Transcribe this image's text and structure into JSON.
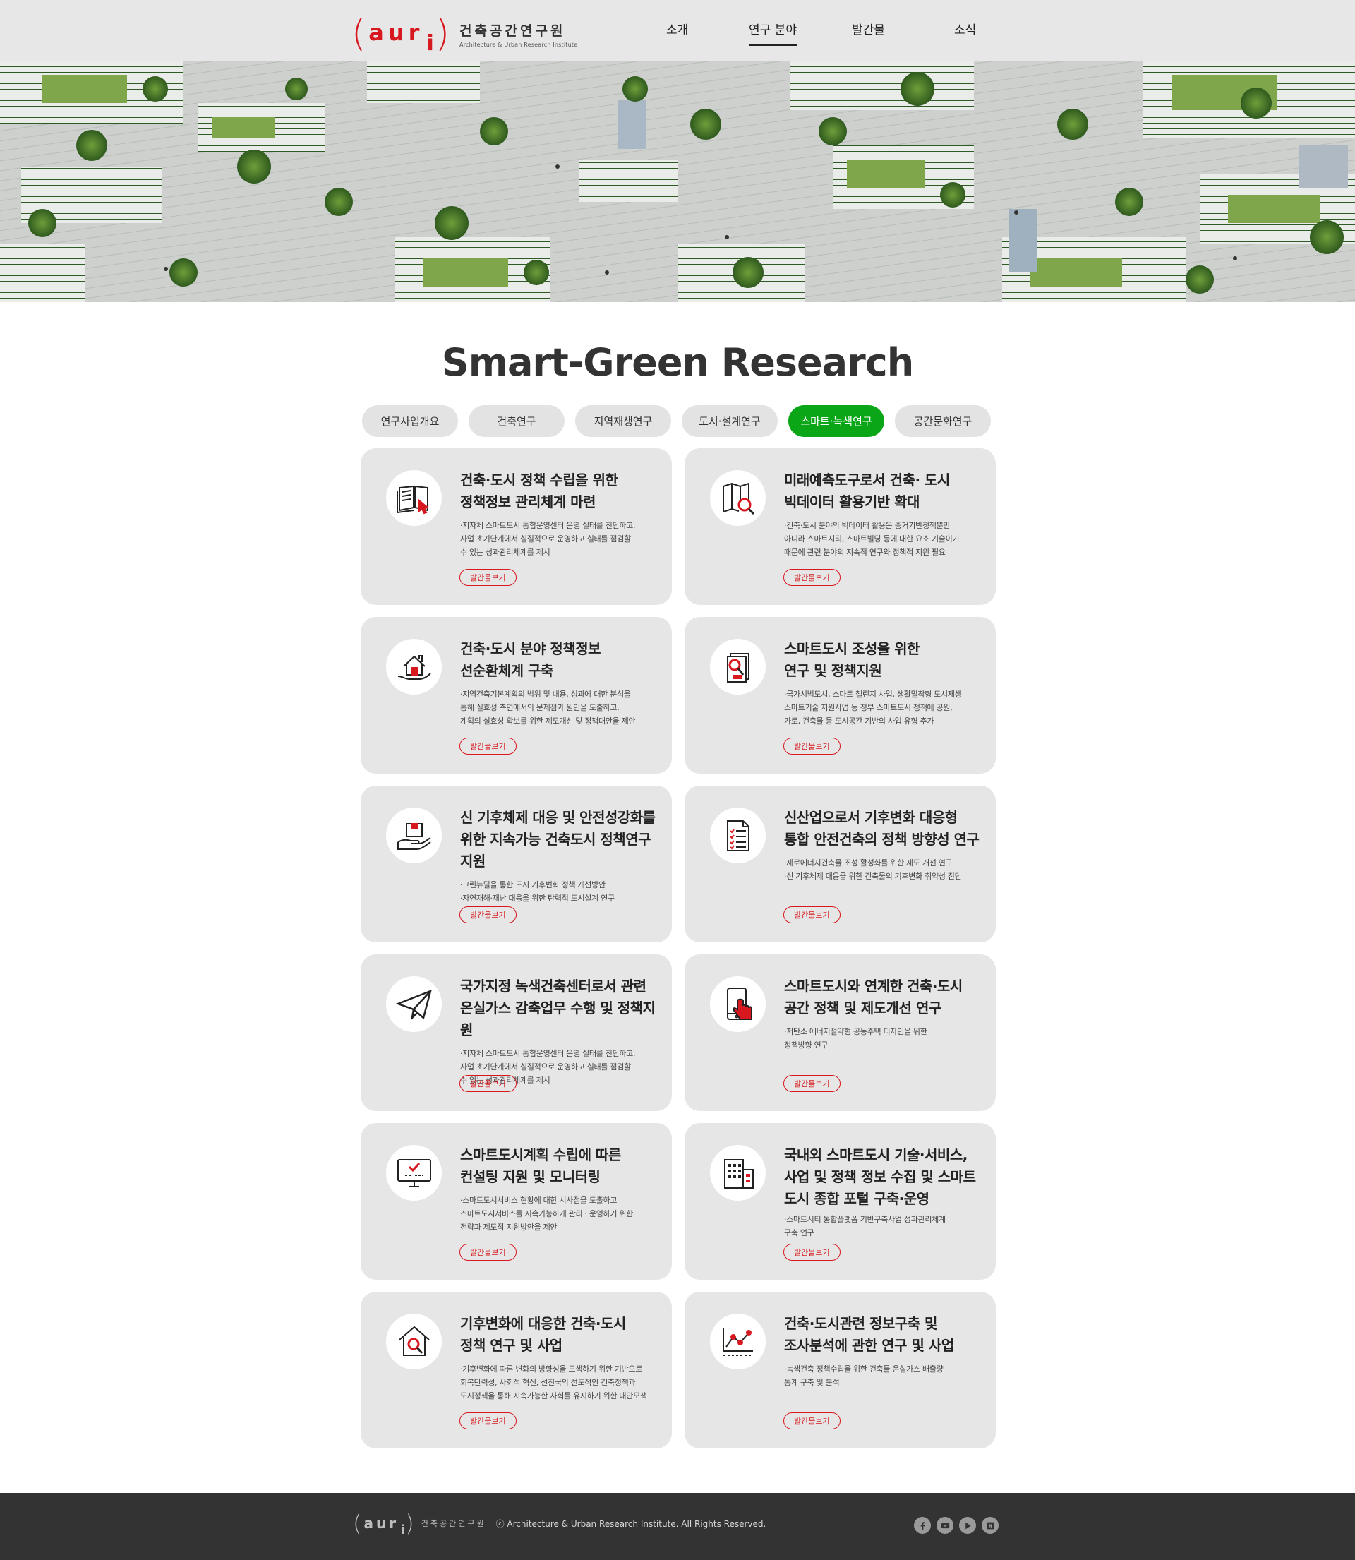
{
  "header": {
    "logo_mark": "aur",
    "logo_sub": "i",
    "logo_kr": "건축공간연구원",
    "logo_en": "Architecture & Urban Research Institute",
    "nav": [
      "소개",
      "연구 분야",
      "발간물",
      "소식"
    ],
    "active_nav": "연구 분야"
  },
  "page_title": "Smart-Green Research",
  "tabs": [
    "연구사업개요",
    "건축연구",
    "지역재생연구",
    "도시·설계연구",
    "스마트·녹색연구",
    "공간문화연구"
  ],
  "active_tab": "스마트·녹색연구",
  "cards": [
    {
      "icon": "book-cursor-icon",
      "title": "건축·도시 정책 수립을 위한\n정책정보 관리체계 마련",
      "desc": "·지자체 스마트도시 통합운영센터 운영 실태를 진단하고,\n사업 초기단계에서 실질적으로 운영하고 실태를 점검할\n수 있는 성과관리체계를 제시",
      "btn": "발간물보기"
    },
    {
      "icon": "map-search-icon",
      "title": "미래예측도구로서 건축· 도시\n빅데이터 활용기반 확대",
      "desc": "·건축·도시 분야의 빅데이터 활용은 증거기반정책뿐만\n아니라 스마트시티, 스마트빌딩 등에 대한 요소 기술이기\n때문에 관련 분야의 지속적 연구와 정책적 지원 필요",
      "btn": "발간물보기"
    },
    {
      "icon": "house-hand-icon",
      "title": "건축·도시 분야 정책정보\n선순환체계 구축",
      "desc": "·지역건축기본계획의 범위 및 내용, 성과에 대한 분석을\n통해 실효성 측면에서의 문제점과 원인을 도출하고,\n계획의 실효성 확보를 위한 제도개선 및 정책대안을 제안",
      "btn": "발간물보기"
    },
    {
      "icon": "document-search-icon",
      "title": "스마트도시 조성을 위한\n연구 및 정책지원",
      "desc": "·국가시범도시, 스마트 챌린지 사업, 생활밀착형 도시재생\n스마트기술 지원사업 등 정부 스마트도시 정책에 공원,\n가로, 건축물 등 도시공간 기반의 사업 유형 추가",
      "btn": "발간물보기"
    },
    {
      "icon": "box-hand-icon",
      "title": "신 기후체제 대응 및 안전성강화를\n위한 지속가능 건축도시 정책연구지원",
      "desc": "·그린뉴딜을 통한 도시 기후변화 정책 개선방안\n·자연재해·재난 대응을 위한 탄력적 도시설계 연구",
      "btn": "발간물보기"
    },
    {
      "icon": "checklist-icon",
      "title": "신산업으로서 기후변화 대응형\n통합 안전건축의 정책 방향성 연구",
      "desc": "·제로에너지건축물 조성 활성화를 위한 제도 개선 연구\n·신 기후체제 대응을 위한 건축물의 기후변화 취약성 진단",
      "btn": "발간물보기"
    },
    {
      "icon": "paper-plane-icon",
      "title": "국가지정 녹색건축센터로서 관련\n온실가스 감축업무 수행 및 정책지원",
      "desc": "·지자체 스마트도시 통합운영센터 운영 실태를 진단하고,\n사업 초기단계에서 실질적으로 운영하고 실태를 점검할\n수 있는 성과관리체계를 제시",
      "btn": "발간물보기"
    },
    {
      "icon": "smartphone-touch-icon",
      "title": "스마트도시와 연계한 건축·도시\n공간 정책 및 제도개선 연구",
      "desc": "·저탄소 에너지절약형 공동주택 디자인을 위한\n정책방향 연구",
      "btn": "발간물보기"
    },
    {
      "icon": "monitor-check-icon",
      "title": "스마트도시계획 수립에 따른\n컨설팅 지원 및 모니터링",
      "desc": "·스마트도시서비스 현황에 대한 시사점을 도출하고\n스마트도시서비스를 지속가능하게 관리 · 운영하기 위한\n전략과 제도적 지원방안을 제안",
      "btn": "발간물보기"
    },
    {
      "icon": "building-icon",
      "title": "국내외 스마트도시 기술·서비스,\n사업 및 정책 정보 수집 및 스마트\n도시 종합 포털 구축·운영",
      "desc": "·스마트시티 통합플랫폼 기반구축사업 성과관리체계\n구축 연구",
      "btn": "발간물보기"
    },
    {
      "icon": "house-search-icon",
      "title": "기후변화에 대응한 건축·도시\n정책 연구 및 사업",
      "desc": "·기후변화에 따른 변화의 방향성을 모색하기 위한 기반으로\n회복탄력성, 사회적 혁신, 선진국의 선도적인 건축정책과\n도시정책을 통해 지속가능한 사회를 유지하기 위한 대안모색",
      "btn": "발간물보기"
    },
    {
      "icon": "line-chart-icon",
      "title": "건축·도시관련 정보구축 및\n조사분석에 관한 연구 및 사업",
      "desc": "·녹색건축 정책수립을 위한 건축물 온실가스 배출량\n통계 구축 및 분석",
      "btn": "발간물보기"
    }
  ],
  "footer": {
    "logo_mark": "aur",
    "logo_sub": "i",
    "logo_kr": "건축공간연구원",
    "copyright": "ⓒ Architecture & Urban Research Institute. All Rights Reserved.",
    "socials": [
      "facebook-icon",
      "youtube-icon",
      "play-icon",
      "naver-icon"
    ]
  },
  "colors": {
    "accent_red": "#d7191f",
    "active_green": "#0aa617",
    "footer_bg": "#333333",
    "card_bg": "#e6e6e6"
  }
}
